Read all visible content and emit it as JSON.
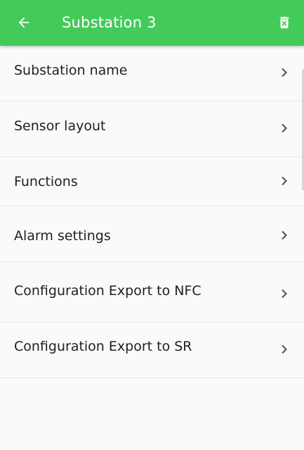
{
  "app_bar": {
    "title": "Substation 3",
    "back_icon": "arrow-left-icon",
    "delete_icon": "trash-icon",
    "color": "#43cb5a"
  },
  "menu": {
    "items": [
      {
        "label": "Substation name",
        "icon": "chevron-right-icon"
      },
      {
        "label": "Sensor layout",
        "icon": "chevron-right-icon"
      },
      {
        "label": "Functions",
        "icon": "chevron-right-icon"
      },
      {
        "label": "Alarm settings",
        "icon": "chevron-right-icon"
      },
      {
        "label": "Configuration Export to NFC",
        "icon": "chevron-right-icon"
      },
      {
        "label": "Configuration Export to SR",
        "icon": "chevron-right-icon"
      }
    ]
  }
}
